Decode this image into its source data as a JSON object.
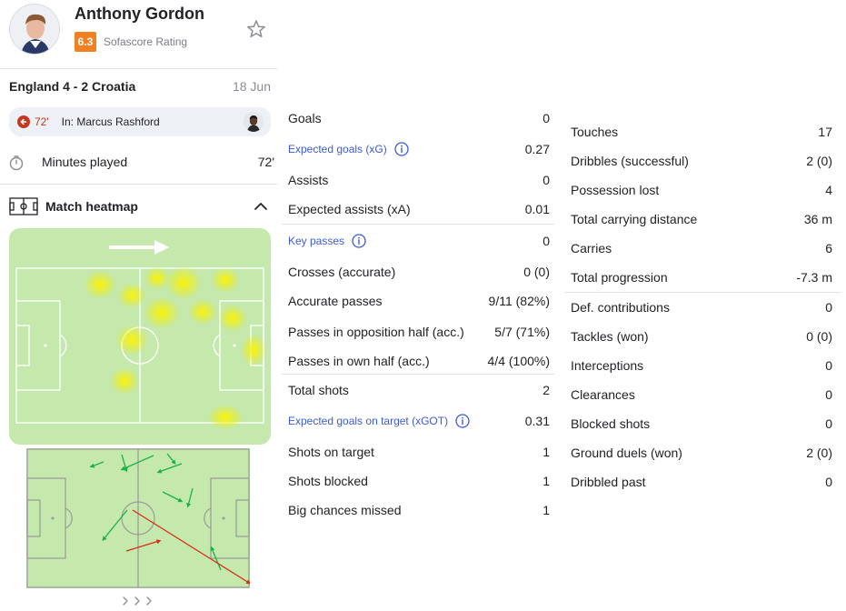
{
  "player": {
    "name": "Anthony Gordon",
    "rating": "6.3",
    "rating_label": "Sofascore Rating"
  },
  "match": {
    "title": "England 4 - 2 Croatia",
    "date": "18 Jun"
  },
  "substitution": {
    "minute": "72'",
    "player_in": "In: Marcus Rashford"
  },
  "minutes": {
    "label": "Minutes played",
    "value": "72'"
  },
  "heatmap": {
    "title": "Match heatmap"
  },
  "colors": {
    "accent": "#f08022",
    "link": "#3b5bd9",
    "pitch": "#c5e8ac",
    "heat": "#fff200",
    "pass_success": "#19b24a",
    "pass_fail": "#d92d1c"
  },
  "stats_middle": [
    {
      "label": "Goals",
      "value": "0"
    },
    {
      "label": "Expected goals (xG)",
      "value": "0.27",
      "link": true
    },
    {
      "label": "Assists",
      "value": "0"
    },
    {
      "label": "Expected assists (xA)",
      "value": "0.01"
    },
    {
      "label": "Key passes",
      "value": "0",
      "link": true
    },
    {
      "label": "Crosses (accurate)",
      "value": "0 (0)"
    },
    {
      "label": "Accurate passes",
      "value": "9/11 (82%)"
    },
    {
      "label": "Passes in opposition half (acc.)",
      "value": "5/7 (71%)"
    },
    {
      "label": "Passes in own half (acc.)",
      "value": "4/4 (100%)"
    },
    {
      "label": "Total shots",
      "value": "2"
    },
    {
      "label": "Expected goals on target (xGOT)",
      "value": "0.31",
      "link": true
    },
    {
      "label": "Shots on target",
      "value": "1"
    },
    {
      "label": "Shots blocked",
      "value": "1"
    },
    {
      "label": "Big chances missed",
      "value": "1"
    }
  ],
  "stats_right": [
    {
      "label": "Touches",
      "value": "17"
    },
    {
      "label": "Dribbles (successful)",
      "value": "2 (0)"
    },
    {
      "label": "Possession lost",
      "value": "4"
    },
    {
      "label": "Total carrying distance",
      "value": "36 m"
    },
    {
      "label": "Carries",
      "value": "6"
    },
    {
      "label": "Total progression",
      "value": "-7.3 m"
    },
    {
      "label": "Def. contributions",
      "value": "0"
    },
    {
      "label": "Tackles (won)",
      "value": "0 (0)"
    },
    {
      "label": "Interceptions",
      "value": "0"
    },
    {
      "label": "Clearances",
      "value": "0"
    },
    {
      "label": "Blocked shots",
      "value": "0"
    },
    {
      "label": "Ground duels (won)",
      "value": "2 (0)"
    },
    {
      "label": "Dribbled past",
      "value": "0"
    }
  ]
}
